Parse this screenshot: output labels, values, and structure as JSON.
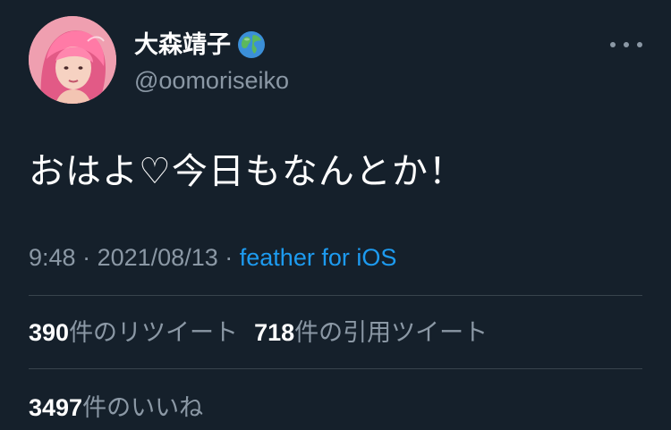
{
  "author": {
    "display_name": "大森靖子",
    "name_emoji": "globe-icon",
    "handle": "@oomoriseiko"
  },
  "tweet": {
    "text": "おはよ♡今日もなんとか！",
    "time": "9:48",
    "separator": "·",
    "date": "2021/08/13",
    "source": "feather for iOS"
  },
  "stats": {
    "retweets_count": "390",
    "retweets_label": "件のリツイート",
    "quotes_count": "718",
    "quotes_label": "件の引用ツイート",
    "likes_count": "3497",
    "likes_label": "件のいいね"
  },
  "colors": {
    "background": "#15202b",
    "text": "#ffffff",
    "secondary_text": "#8b98a5",
    "link": "#1d9bf0",
    "divider": "#38444d"
  }
}
